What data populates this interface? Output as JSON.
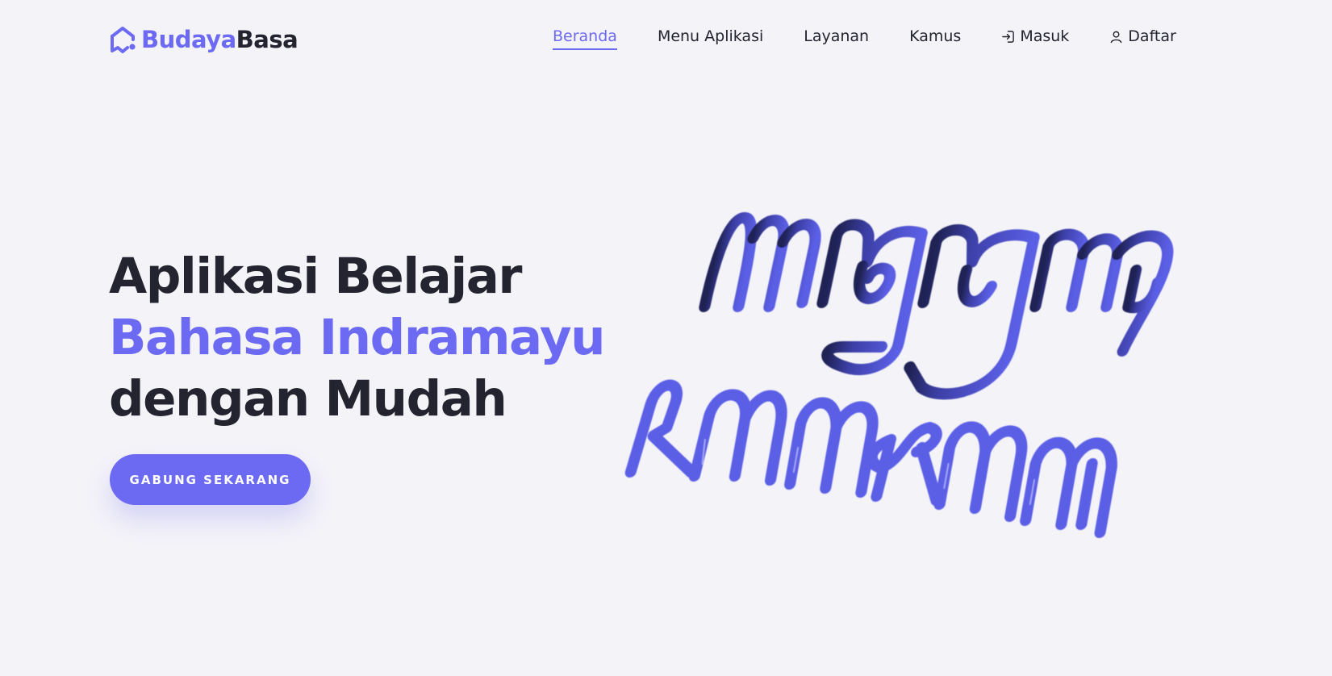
{
  "brand": {
    "name_part1": "Budaya",
    "name_part2": "Basa",
    "icon": "house-logo-icon"
  },
  "nav": {
    "items": [
      {
        "label": "Beranda",
        "active": true
      },
      {
        "label": "Menu Aplikasi",
        "active": false
      },
      {
        "label": "Layanan",
        "active": false
      },
      {
        "label": "Kamus",
        "active": false
      },
      {
        "label": "Masuk",
        "icon": "login-icon",
        "active": false
      },
      {
        "label": "Daftar",
        "icon": "user-icon",
        "active": false
      }
    ]
  },
  "hero": {
    "line1": "Aplikasi Belajar",
    "line2": "Bahasa Indramayu",
    "line3": "dengan Mudah",
    "cta_label": "GABUNG SEKARANG"
  },
  "illustration": {
    "description_icon": "javanese-script-illustration"
  },
  "colors": {
    "accent": "#6c6af2",
    "text": "#23242f",
    "background": "#f4f3f8"
  }
}
